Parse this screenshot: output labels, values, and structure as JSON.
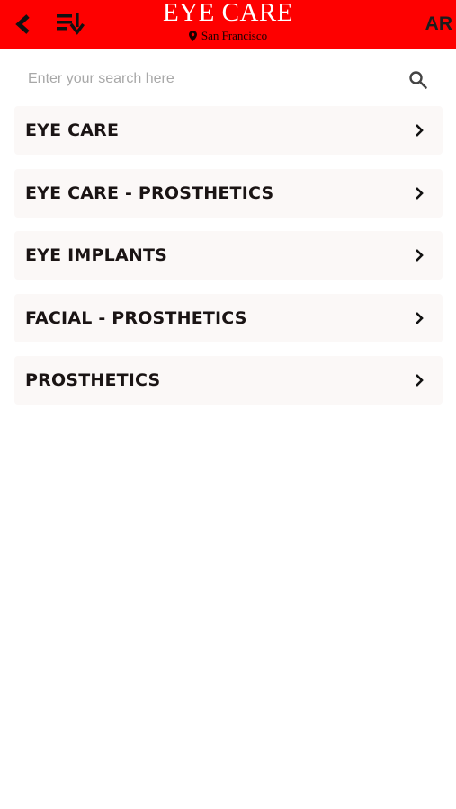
{
  "header": {
    "title": "EYE CARE",
    "location": "San Francisco",
    "language_button": "AR",
    "background_color": "#fe0000",
    "icons": [
      "back-arrow-icon",
      "sort-icon",
      "location-pin-icon"
    ]
  },
  "search": {
    "placeholder": "Enter your search here",
    "value": "",
    "icon": "search-icon"
  },
  "categories": [
    {
      "label": "EYE CARE"
    },
    {
      "label": "EYE CARE - PROSTHETICS"
    },
    {
      "label": "EYE IMPLANTS"
    },
    {
      "label": "FACIAL - PROSTHETICS"
    },
    {
      "label": "PROSTHETICS"
    }
  ]
}
